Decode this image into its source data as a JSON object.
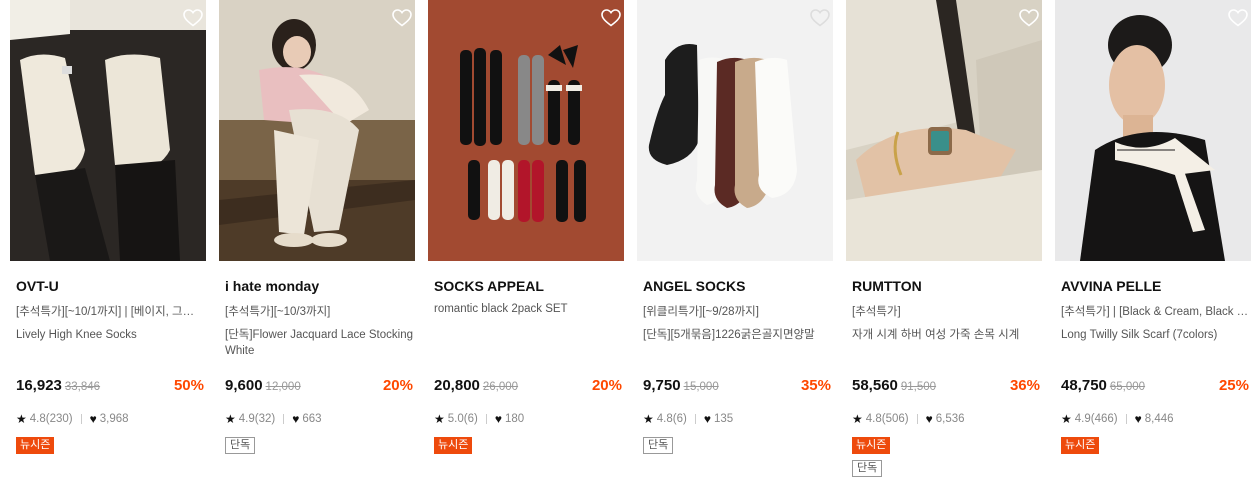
{
  "products": [
    {
      "brand": "OVT-U",
      "promo": "[추석특가][~10/1까지] | [베이지, 그레…",
      "name": "Lively High Knee Socks",
      "price": "16,923",
      "original_price": "33,846",
      "discount": "50%",
      "rating": "4.8(230)",
      "likes": "3,968",
      "badges": [
        "뉴시즌"
      ],
      "image": "cream-knee-socks-photo"
    },
    {
      "brand": "i hate monday",
      "promo": "[추석특가][~10/3까지]",
      "name": "[단독]Flower Jacquard Lace Stocking White",
      "price": "9,600",
      "original_price": "12,000",
      "discount": "20%",
      "rating": "4.9(32)",
      "likes": "663",
      "badges": [
        "단독"
      ],
      "image": "lace-stocking-model-photo"
    },
    {
      "brand": "SOCKS APPEAL",
      "promo": "romantic black 2pack SET",
      "name": "",
      "price": "20,800",
      "original_price": "26,000",
      "discount": "20%",
      "rating": "5.0(6)",
      "likes": "180",
      "badges": [
        "뉴시즌"
      ],
      "image": "sock-set-flatlay-photo"
    },
    {
      "brand": "ANGEL SOCKS",
      "promo": "[위클리특가][~9/28까지]",
      "name": "[단독][5개묶음]1226굵은골지면양말",
      "price": "9,750",
      "original_price": "15,000",
      "discount": "35%",
      "rating": "4.8(6)",
      "likes": "135",
      "badges": [
        "단독"
      ],
      "image": "ribbed-socks-photo"
    },
    {
      "brand": "RUMTTON",
      "promo": "[추석특가]",
      "name": "자개 시계 하버 여성 가죽 손목 시계",
      "price": "58,560",
      "original_price": "91,500",
      "discount": "36%",
      "rating": "4.8(506)",
      "likes": "6,536",
      "badges": [
        "뉴시즌",
        "단독"
      ],
      "image": "wrist-watch-photo"
    },
    {
      "brand": "AVVINA PELLE",
      "promo": "[추석특가] | [Black & Cream, Black …",
      "name": "Long Twilly Silk Scarf (7colors)",
      "price": "48,750",
      "original_price": "65,000",
      "discount": "25%",
      "rating": "4.9(466)",
      "likes": "8,446",
      "badges": [
        "뉴시즌"
      ],
      "image": "silk-scarf-model-photo"
    }
  ],
  "icons": {
    "wishlist": "heart-outline-icon",
    "rating": "star-icon",
    "likes": "heart-filled-icon"
  },
  "colors": {
    "discount": "#ff4800",
    "new_season_badge": "#ee4a0c"
  }
}
